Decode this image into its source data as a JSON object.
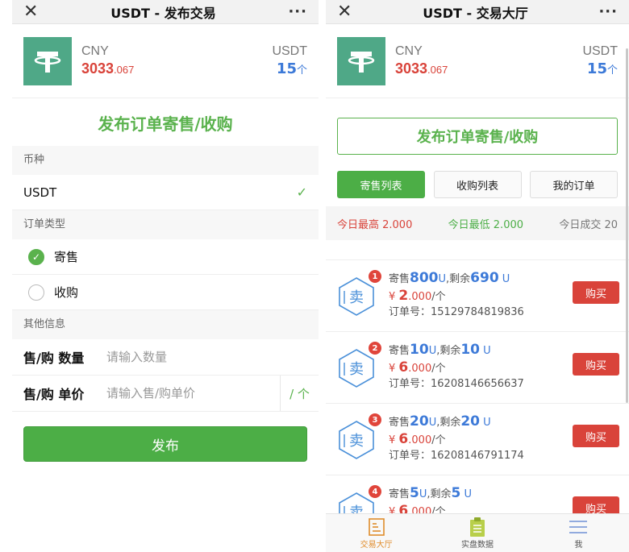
{
  "left": {
    "title": "USDT - 发布交易",
    "close_icon": "✕",
    "more_icon": "···",
    "balance": {
      "currency": "CNY",
      "amount_main": "3033",
      "amount_decimal": ".067",
      "coin": "USDT",
      "coin_amount": "15",
      "coin_unit": "个"
    },
    "heading": "发布订单寄售/收购",
    "coin_section": "币种",
    "coin_value": "USDT",
    "type_section": "订单类型",
    "type_options": [
      {
        "label": "寄售",
        "selected": true
      },
      {
        "label": "收购",
        "selected": false
      }
    ],
    "other_section": "其他信息",
    "qty_label": "售/购 数量",
    "qty_placeholder": "请输入数量",
    "price_label": "售/购 单价",
    "price_placeholder": "请输入售/购单价",
    "price_unit": "/ 个",
    "submit_label": "发布"
  },
  "right": {
    "title": "USDT - 交易大厅",
    "balance": {
      "currency": "CNY",
      "amount_main": "3033",
      "amount_decimal": ".067",
      "coin": "USDT",
      "coin_amount": "15",
      "coin_unit": "个"
    },
    "publish_label": "发布订单寄售/收购",
    "tabs": [
      "寄售列表",
      "收购列表",
      "我的订单"
    ],
    "stats": {
      "high": "今日最高 2.000",
      "low": "今日最低 2.000",
      "deals": "今日成交 20"
    },
    "orders": [
      {
        "rank": "1",
        "prefix": "寄售",
        "amount": "800",
        "unit": "U",
        "remain_label": ",剩余",
        "remain": "690",
        "remain_unit": " U",
        "currency_symbol": "¥",
        "price_int": "2",
        "price_dec": ".000",
        "per": "/个",
        "order_no": "订单号：15129784819836",
        "buy_label": "购买",
        "sell_char": "卖"
      },
      {
        "rank": "2",
        "prefix": "寄售",
        "amount": "10",
        "unit": "U",
        "remain_label": ",剩余",
        "remain": "10",
        "remain_unit": " U",
        "currency_symbol": "¥",
        "price_int": "6",
        "price_dec": ".000",
        "per": "/个",
        "order_no": "订单号：16208146656637",
        "buy_label": "购买",
        "sell_char": "卖"
      },
      {
        "rank": "3",
        "prefix": "寄售",
        "amount": "20",
        "unit": "U",
        "remain_label": ",剩余",
        "remain": "20",
        "remain_unit": " U",
        "currency_symbol": "¥",
        "price_int": "6",
        "price_dec": ".000",
        "per": "/个",
        "order_no": "订单号：16208146791174",
        "buy_label": "购买",
        "sell_char": "卖"
      },
      {
        "rank": "4",
        "prefix": "寄售",
        "amount": "5",
        "unit": "U",
        "remain_label": ",剩余",
        "remain": "5",
        "remain_unit": " U",
        "currency_symbol": "¥",
        "price_int": "6",
        "price_dec": ".000",
        "per": "/个",
        "order_no": "",
        "buy_label": "购买",
        "sell_char": "卖"
      }
    ],
    "nav": [
      {
        "label": "交易大厅",
        "icon": "hall-icon",
        "active": true
      },
      {
        "label": "实盘数据",
        "icon": "clipboard-icon",
        "active": false
      },
      {
        "label": "我",
        "icon": "menu-icon",
        "active": false
      }
    ]
  },
  "colors": {
    "green": "#4cae46",
    "red": "#d9433a",
    "blue": "#3d7ad8",
    "tether": "#4fa887",
    "nav_active": "#e08c2c"
  }
}
